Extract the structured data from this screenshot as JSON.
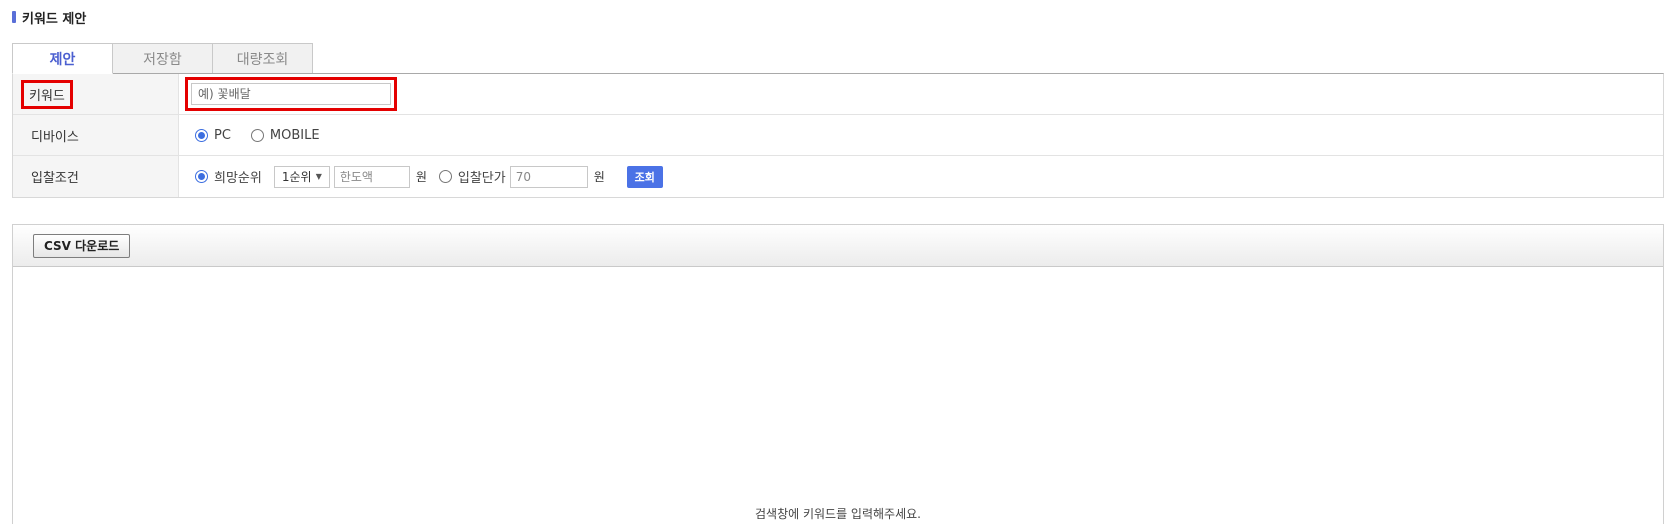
{
  "page": {
    "title": "키워드 제안"
  },
  "tabs": [
    {
      "label": "제안",
      "active": true
    },
    {
      "label": "저장함",
      "active": false
    },
    {
      "label": "대량조회",
      "active": false
    }
  ],
  "form": {
    "keyword": {
      "label": "키워드",
      "placeholder": "예) 꽃배달"
    },
    "device": {
      "label": "디바이스",
      "options": [
        "PC",
        "MOBILE"
      ],
      "selected": "PC"
    },
    "bid": {
      "label": "입찰조건",
      "option1": "희망순위",
      "rank_select": "1순위",
      "limit_placeholder": "한도액",
      "unit": "원",
      "option2": "입찰단가",
      "price_placeholder": "70",
      "search_button": "조회"
    }
  },
  "grid": {
    "csv_button": "CSV 다운로드",
    "empty_message": "검색창에 키워드를 입력해주세요."
  },
  "colors": {
    "accent": "#4b5fd0",
    "highlight": "#e40000",
    "button_blue": "#4b72e6"
  }
}
